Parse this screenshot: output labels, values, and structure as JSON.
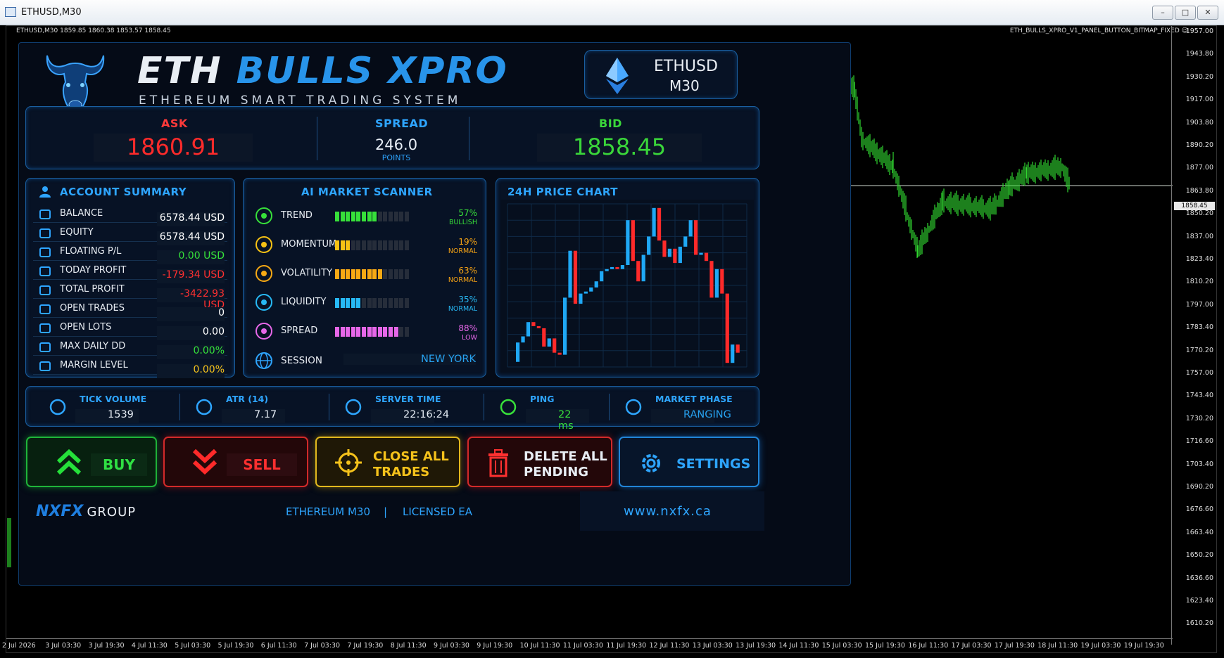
{
  "window": {
    "title": "ETHUSD,M30",
    "min": "–",
    "max": "□",
    "close": "✕"
  },
  "chart": {
    "symbol_line": "ETHUSD,M30 1859.85 1860.38 1853.57 1858.45",
    "ea_name": "ETH_BULLS_XPRO_V1_PANEL_BUTTON_BITMAP_FIXED ☺",
    "current_price": "1858.45",
    "y_labels": [
      "1957.00",
      "1943.80",
      "1930.20",
      "1917.00",
      "1903.80",
      "1890.20",
      "1877.00",
      "1863.80",
      "1850.20",
      "1837.00",
      "1823.40",
      "1810.20",
      "1797.00",
      "1783.40",
      "1770.20",
      "1757.00",
      "1743.40",
      "1730.20",
      "1716.60",
      "1703.40",
      "1690.20",
      "1676.60",
      "1663.40",
      "1650.20",
      "1636.60",
      "1623.40",
      "1610.20"
    ],
    "x_labels": [
      "2 Jul 2026",
      "3 Jul 03:30",
      "3 Jul 19:30",
      "4 Jul 11:30",
      "5 Jul 03:30",
      "5 Jul 19:30",
      "6 Jul 11:30",
      "7 Jul 03:30",
      "7 Jul 19:30",
      "8 Jul 11:30",
      "9 Jul 03:30",
      "9 Jul 19:30",
      "10 Jul 11:30",
      "11 Jul 03:30",
      "11 Jul 19:30",
      "12 Jul 11:30",
      "13 Jul 03:30",
      "13 Jul 19:30",
      "14 Jul 11:30",
      "15 Jul 03:30",
      "15 Jul 19:30",
      "16 Jul 11:30",
      "17 Jul 03:30",
      "17 Jul 19:30",
      "18 Jul 11:30",
      "19 Jul 03:30",
      "19 Jul 19:30"
    ],
    "colors": {
      "candle": "#3ee03e",
      "bg": "#000000"
    }
  },
  "header": {
    "title_a": "ETH",
    "title_b": "BULLS XPRO",
    "subtitle": "ETHEREUM SMART TRADING SYSTEM",
    "symbol": "ETHUSD",
    "timeframe": "M30"
  },
  "prices": {
    "ask_label": "ASK",
    "ask": "1860.91",
    "spread_label": "SPREAD",
    "spread": "246.0",
    "spread_unit": "POINTS",
    "bid_label": "BID",
    "bid": "1858.45"
  },
  "account": {
    "title": "ACCOUNT SUMMARY",
    "rows": [
      {
        "label": "BALANCE",
        "value": "6578.44 USD",
        "color": "#ffffff"
      },
      {
        "label": "EQUITY",
        "value": "6578.44 USD",
        "color": "#ffffff"
      },
      {
        "label": "FLOATING P/L",
        "value": "0.00 USD",
        "color": "#36e23a"
      },
      {
        "label": "TODAY PROFIT",
        "value": "-179.34 USD",
        "color": "#ff3030"
      },
      {
        "label": "TOTAL PROFIT",
        "value": "-3422.93 USD",
        "color": "#ff3030"
      },
      {
        "label": "OPEN TRADES",
        "value": "0",
        "color": "#ffffff"
      },
      {
        "label": "OPEN LOTS",
        "value": "0.00",
        "color": "#ffffff"
      },
      {
        "label": "MAX DAILY DD",
        "value": "0.00%",
        "color": "#36e23a"
      },
      {
        "label": "MARGIN LEVEL",
        "value": "0.00%",
        "color": "#f5c21b"
      }
    ]
  },
  "scanner": {
    "title": "AI MARKET SCANNER",
    "rows": [
      {
        "label": "TREND",
        "pct": "57%",
        "status": "BULLISH",
        "level": 0.57,
        "color": "#37e03a",
        "scolor": "#37e03a",
        "icon": "trend-up-icon"
      },
      {
        "label": "MOMENTUM",
        "pct": "19%",
        "status": "NORMAL",
        "level": 0.19,
        "color": "#f7c214",
        "scolor": "#f7a414",
        "icon": "lightning-icon"
      },
      {
        "label": "VOLATILITY",
        "pct": "63%",
        "status": "NORMAL",
        "level": 0.63,
        "color": "#f7a914",
        "scolor": "#f7a414",
        "icon": "pulse-icon"
      },
      {
        "label": "LIQUIDITY",
        "pct": "35%",
        "status": "NORMAL",
        "level": 0.35,
        "color": "#27b9f5",
        "scolor": "#27b9f5",
        "icon": "droplet-icon"
      },
      {
        "label": "SPREAD",
        "pct": "88%",
        "status": "LOW",
        "level": 0.88,
        "color": "#e667e8",
        "scolor": "#e667e8",
        "icon": "dots-icon"
      }
    ],
    "session_label": "SESSION",
    "session": "NEW YORK"
  },
  "pricechart": {
    "title": "24H PRICE CHART"
  },
  "chart_data": {
    "type": "candlestick",
    "title": "24H PRICE CHART",
    "candles": [
      [
        1747,
        1770,
        1750,
        1766
      ],
      [
        1766,
        1776,
        1762,
        1772
      ],
      [
        1772,
        1790,
        1770,
        1786
      ],
      [
        1786,
        1790,
        1778,
        1782
      ],
      [
        1782,
        1786,
        1774,
        1780
      ],
      [
        1780,
        1784,
        1760,
        1762
      ],
      [
        1762,
        1775,
        1758,
        1770
      ],
      [
        1770,
        1774,
        1752,
        1756
      ],
      [
        1756,
        1760,
        1748,
        1754
      ],
      [
        1754,
        1814,
        1750,
        1810
      ],
      [
        1810,
        1860,
        1806,
        1856
      ],
      [
        1856,
        1860,
        1800,
        1804
      ],
      [
        1804,
        1818,
        1800,
        1814
      ],
      [
        1814,
        1820,
        1808,
        1816
      ],
      [
        1816,
        1826,
        1810,
        1820
      ],
      [
        1820,
        1830,
        1816,
        1826
      ],
      [
        1826,
        1840,
        1822,
        1836
      ],
      [
        1836,
        1842,
        1832,
        1838
      ],
      [
        1838,
        1842,
        1834,
        1840
      ],
      [
        1840,
        1846,
        1834,
        1838
      ],
      [
        1838,
        1846,
        1834,
        1842
      ],
      [
        1842,
        1890,
        1838,
        1886
      ],
      [
        1886,
        1890,
        1840,
        1846
      ],
      [
        1846,
        1850,
        1820,
        1826
      ],
      [
        1826,
        1856,
        1824,
        1852
      ],
      [
        1852,
        1874,
        1850,
        1870
      ],
      [
        1870,
        1902,
        1866,
        1898
      ],
      [
        1898,
        1902,
        1862,
        1866
      ],
      [
        1866,
        1870,
        1844,
        1850
      ],
      [
        1850,
        1862,
        1846,
        1858
      ],
      [
        1858,
        1864,
        1840,
        1844
      ],
      [
        1844,
        1864,
        1840,
        1860
      ],
      [
        1860,
        1874,
        1856,
        1870
      ],
      [
        1870,
        1890,
        1866,
        1886
      ],
      [
        1886,
        1890,
        1848,
        1852
      ],
      [
        1852,
        1858,
        1844,
        1854
      ],
      [
        1854,
        1858,
        1840,
        1846
      ],
      [
        1846,
        1850,
        1806,
        1810
      ],
      [
        1810,
        1842,
        1806,
        1838
      ],
      [
        1838,
        1842,
        1808,
        1814
      ],
      [
        1814,
        1818,
        1742,
        1746
      ],
      [
        1746,
        1768,
        1744,
        1764
      ],
      [
        1764,
        1770,
        1752,
        1756
      ]
    ]
  },
  "stats": [
    {
      "label": "TICK VOLUME",
      "value": "1539",
      "color": "#e6edf5",
      "icon": "bars-icon"
    },
    {
      "label": "ATR (14)",
      "value": "7.17",
      "color": "#e6edf5",
      "icon": "wave-icon"
    },
    {
      "label": "SERVER TIME",
      "value": "22:16:24",
      "color": "#e6edf5",
      "icon": "clock-icon"
    },
    {
      "label": "PING",
      "value": "22 ms",
      "color": "#38e03a",
      "icon": "wifi-icon"
    },
    {
      "label": "MARKET PHASE",
      "value": "RANGING",
      "color": "#27a2f0",
      "icon": "phase-icon"
    }
  ],
  "buttons": {
    "buy": "BUY",
    "sell": "SELL",
    "close_all_1": "CLOSE ALL",
    "close_all_2": "TRADES",
    "delete_1": "DELETE ALL",
    "delete_2": "PENDING",
    "settings": "SETTINGS"
  },
  "footer": {
    "brand_a": "NXFX",
    "brand_b": "GROUP",
    "info_1": "ETHEREUM M30",
    "sep": "|",
    "info_2": "LICENSED EA",
    "url": "www.nxfx.ca"
  }
}
